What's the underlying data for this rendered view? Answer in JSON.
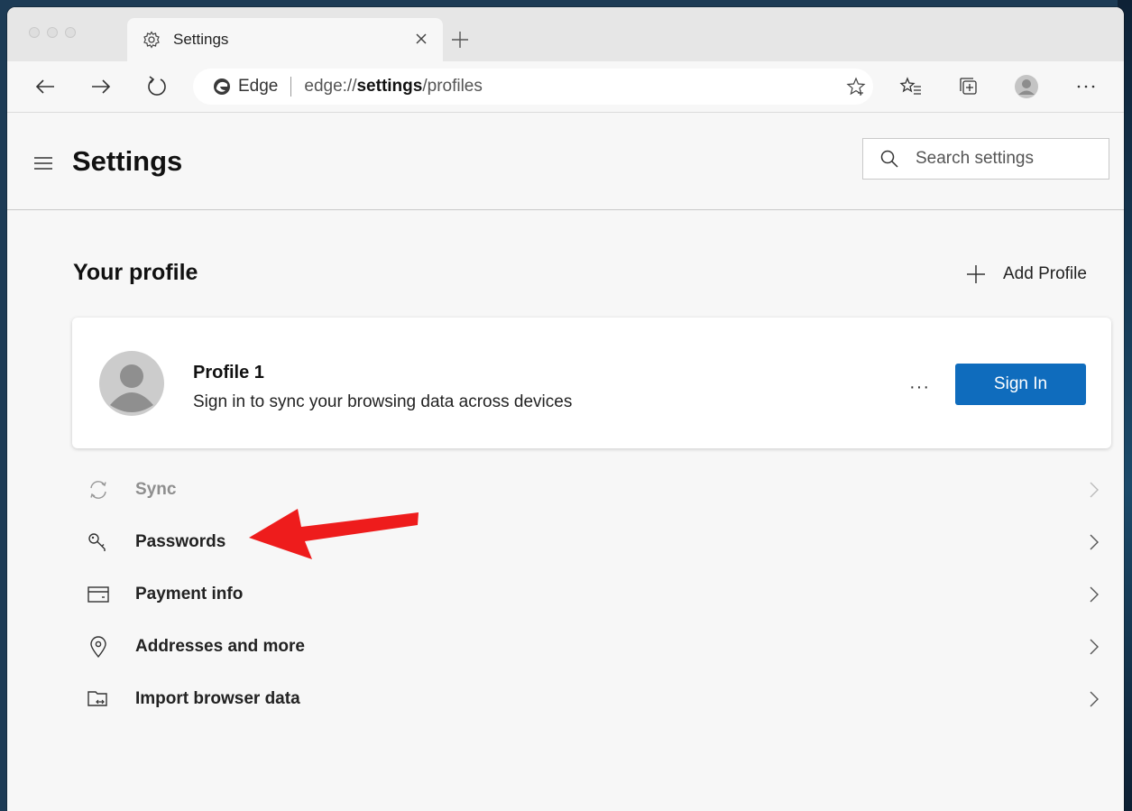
{
  "window": {
    "tab_title": "Settings"
  },
  "toolbar": {
    "site_name": "Edge",
    "url_prefix": "edge://",
    "url_bold": "settings",
    "url_suffix": "/profiles"
  },
  "settings": {
    "title": "Settings",
    "search_placeholder": "Search settings"
  },
  "profile_section": {
    "title": "Your profile",
    "add_profile_label": "Add Profile",
    "profile_name": "Profile 1",
    "profile_subtitle": "Sign in to sync your browsing data across devices",
    "more_label": "···",
    "sign_in_label": "Sign In"
  },
  "list_items": [
    {
      "label": "Sync",
      "icon": "sync-icon",
      "enabled": false
    },
    {
      "label": "Passwords",
      "icon": "key-icon",
      "enabled": true
    },
    {
      "label": "Payment info",
      "icon": "card-icon",
      "enabled": true
    },
    {
      "label": "Addresses and more",
      "icon": "location-pin-icon",
      "enabled": true
    },
    {
      "label": "Import browser data",
      "icon": "import-icon",
      "enabled": true
    }
  ],
  "colors": {
    "accent": "#0f6cbd",
    "annotation_arrow": "#ee1c1c"
  }
}
